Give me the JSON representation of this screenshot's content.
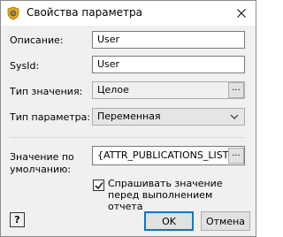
{
  "window": {
    "title": "Свойства параметра"
  },
  "form": {
    "description": {
      "label": "Описание:",
      "value": "User"
    },
    "sysid": {
      "label": "SysId:",
      "value": "User"
    },
    "value_type": {
      "label": "Тип значения:",
      "value": "Целое",
      "browse_label": "..."
    },
    "param_type": {
      "label": "Тип параметра:",
      "value": "Переменная"
    },
    "default_value": {
      "label_line1": "Значение по",
      "label_line2": "умолчанию:",
      "value": "{ATTR_PUBLICATIONS_LIST_T...",
      "browse_label": "..."
    },
    "ask_value": {
      "label": "Спрашивать значение перед выполнением отчета",
      "checked": true
    }
  },
  "buttons": {
    "help": "?",
    "ok": "OK",
    "cancel": "Отмена"
  },
  "colors": {
    "title_bg": "#ffffff",
    "dialog_bg": "#f0f0f0",
    "accent": "#0078d7"
  },
  "icons": {
    "app": "shield-gear-icon",
    "close": "close-icon",
    "dropdown": "chevron-down-icon",
    "check": "checkmark-icon"
  }
}
